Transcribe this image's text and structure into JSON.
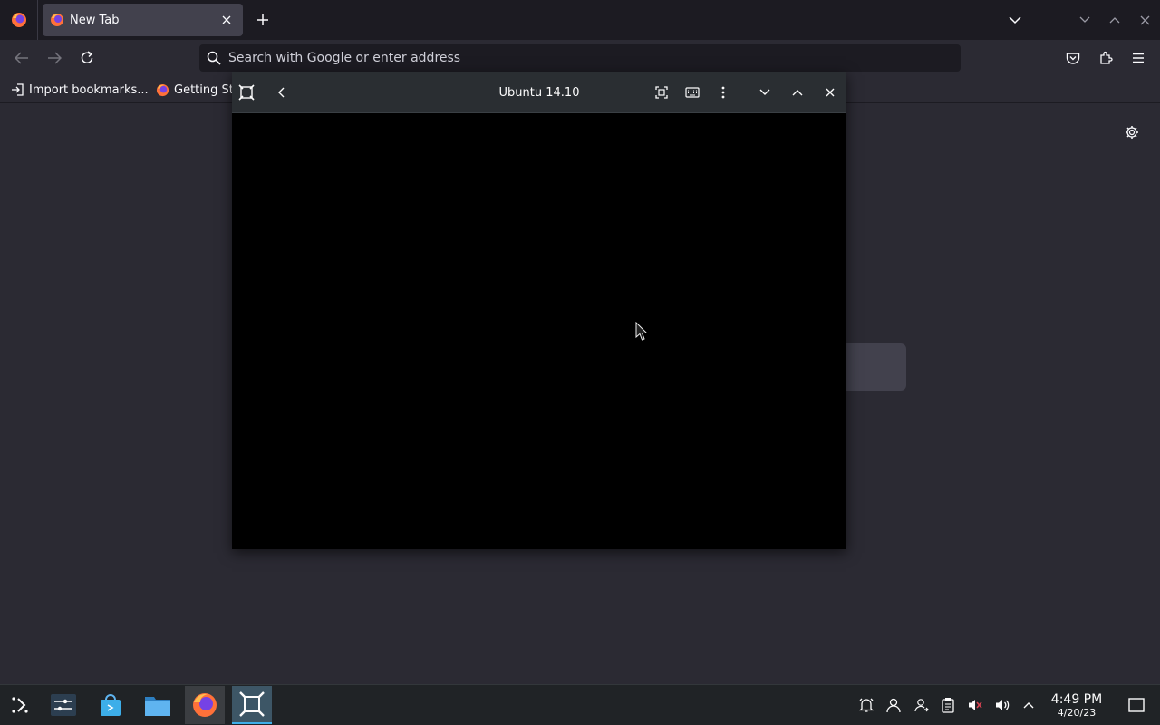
{
  "browser": {
    "tab": {
      "title": "New Tab"
    },
    "urlbar": {
      "placeholder": "Search with Google or enter address"
    },
    "bookmarks": [
      {
        "label": "Import bookmarks..."
      },
      {
        "label": "Getting Started"
      }
    ]
  },
  "app_window": {
    "title": "Ubuntu 14.10"
  },
  "taskbar": {
    "clock": {
      "time": "4:49 PM",
      "date": "4/20/23"
    }
  },
  "colors": {
    "browser_bg": "#2b2a33",
    "tabbar_bg": "#1c1b22",
    "taskbar_bg": "#202326",
    "accent": "#3daee9"
  }
}
